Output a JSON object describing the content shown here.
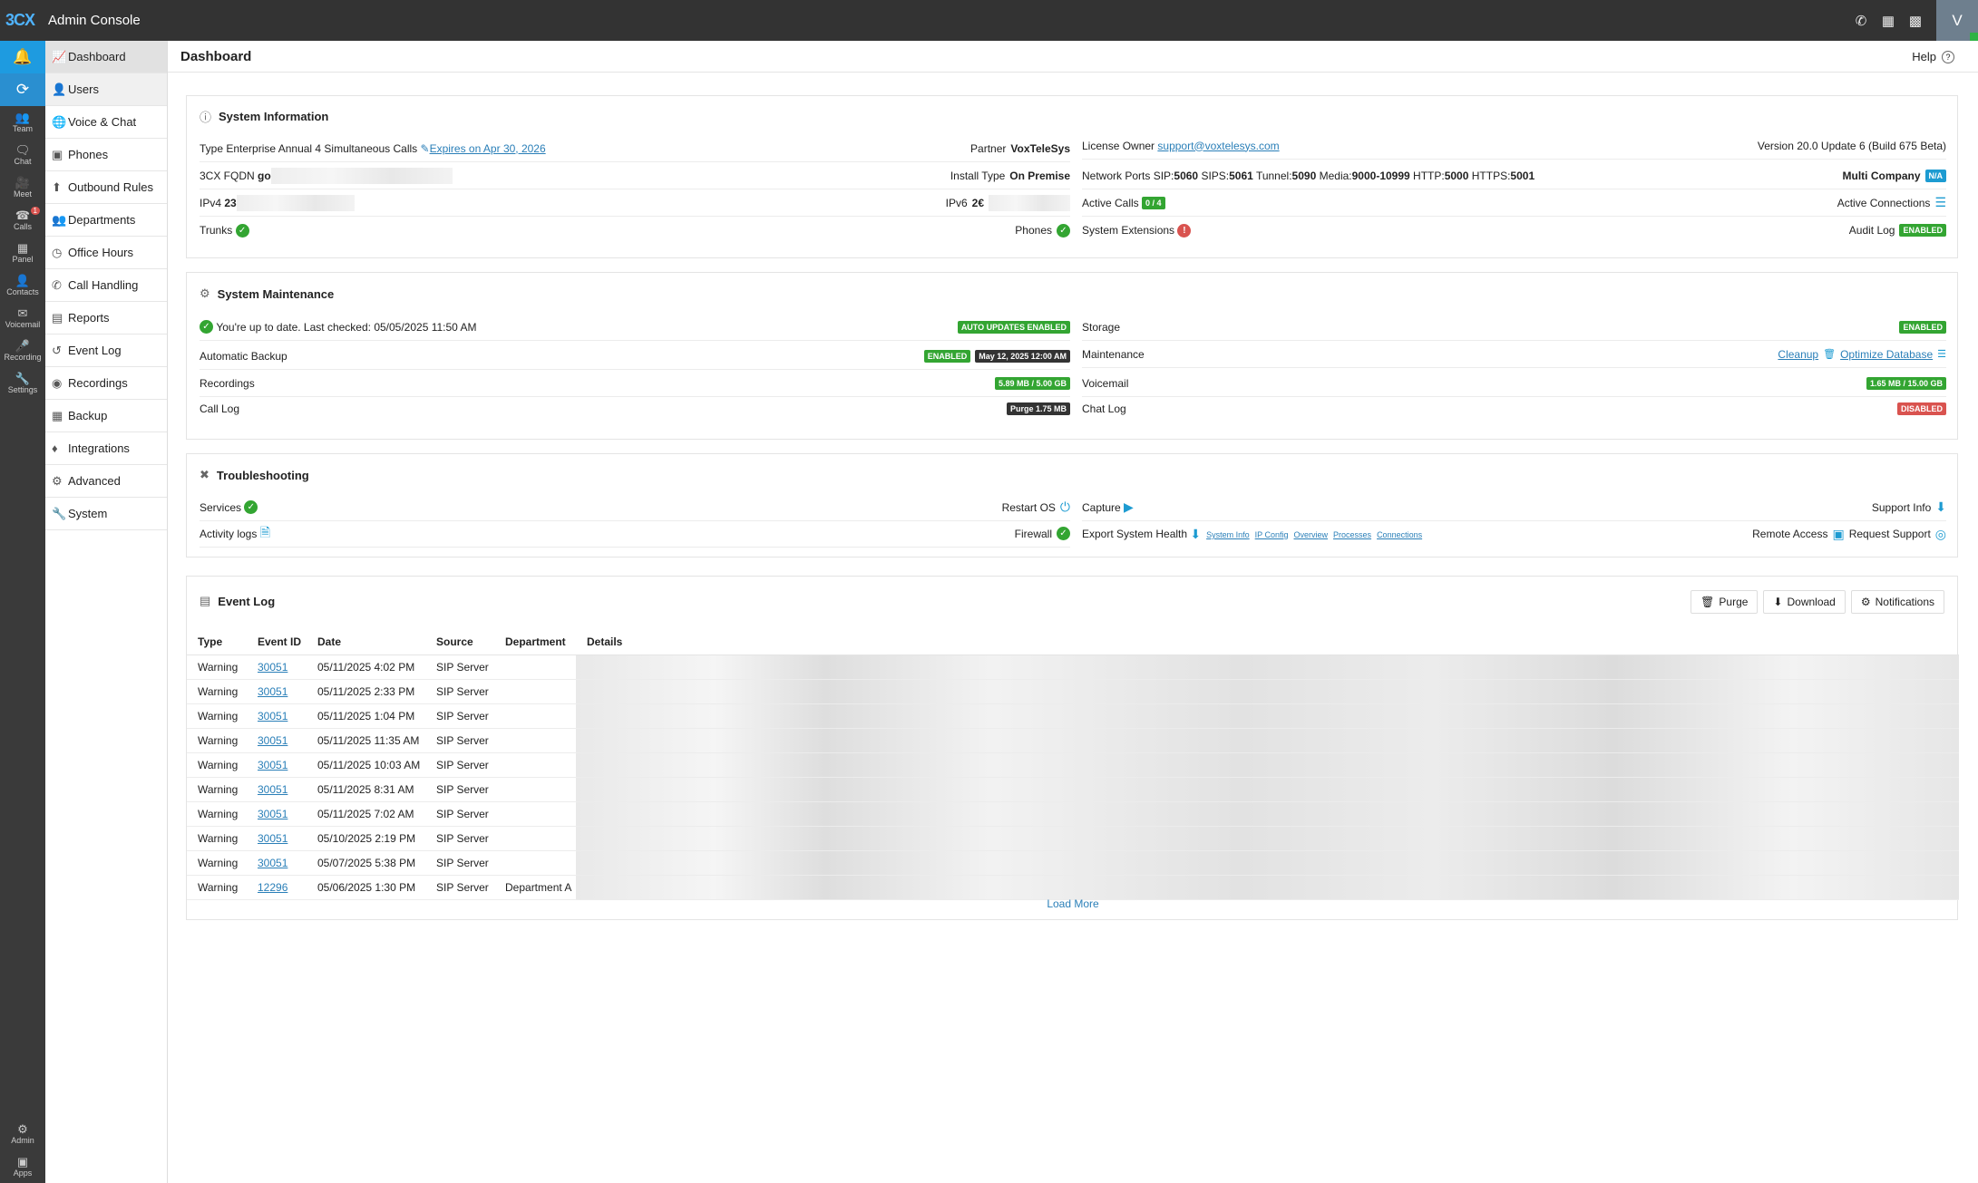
{
  "app": {
    "logo": "3CX",
    "title": "Admin Console",
    "avatar_initial": "V"
  },
  "topbar_icons": [
    "phone-icon",
    "qr-code-icon",
    "book-icon"
  ],
  "rail": {
    "items": [
      {
        "label": "Team",
        "icon": "team-icon"
      },
      {
        "label": "Chat",
        "icon": "chat-icon"
      },
      {
        "label": "Meet",
        "icon": "meet-icon"
      },
      {
        "label": "Calls",
        "icon": "calls-icon",
        "badge": "1"
      },
      {
        "label": "Panel",
        "icon": "panel-icon"
      },
      {
        "label": "Contacts",
        "icon": "contacts-icon"
      },
      {
        "label": "Voicemail",
        "icon": "voicemail-icon"
      },
      {
        "label": "Recording",
        "icon": "recording-icon"
      },
      {
        "label": "Settings",
        "icon": "settings-icon"
      }
    ],
    "bottom": [
      {
        "label": "Admin",
        "icon": "admin-icon"
      },
      {
        "label": "Apps",
        "icon": "apps-icon"
      }
    ]
  },
  "sidebar": {
    "items": [
      {
        "label": "Dashboard"
      },
      {
        "label": "Users"
      },
      {
        "label": "Voice & Chat"
      },
      {
        "label": "Phones"
      },
      {
        "label": "Outbound Rules"
      },
      {
        "label": "Departments"
      },
      {
        "label": "Office Hours"
      },
      {
        "label": "Call Handling"
      },
      {
        "label": "Reports"
      },
      {
        "label": "Event Log"
      },
      {
        "label": "Recordings"
      },
      {
        "label": "Backup"
      },
      {
        "label": "Integrations"
      },
      {
        "label": "Advanced"
      },
      {
        "label": "System"
      }
    ]
  },
  "header": {
    "title": "Dashboard",
    "help": "Help"
  },
  "sysinfo": {
    "title": "System Information",
    "type_label": "Type",
    "type_value": "Enterprise Annual  4 Simultaneous Calls",
    "expires": "Expires on Apr 30, 2026",
    "partner_label": "Partner",
    "partner_value": "VoxTeleSys",
    "license_owner_label": "License Owner",
    "license_owner_value": "support@voxtelesys.com",
    "version": "Version 20.0 Update 6 (Build 675 Beta)",
    "fqdn_label": "3CX FQDN",
    "fqdn_value": "go",
    "install_label": "Install Type",
    "install_value": "On Premise",
    "ports_label": "Network Ports",
    "ports": [
      {
        "k": "SIP:",
        "v": "5060"
      },
      {
        "k": "SIPS:",
        "v": "5061"
      },
      {
        "k": "Tunnel:",
        "v": "5090"
      },
      {
        "k": "Media:",
        "v": "9000-10999"
      },
      {
        "k": "HTTP:",
        "v": "5000"
      },
      {
        "k": "HTTPS:",
        "v": "5001"
      }
    ],
    "multi_company": "Multi Company",
    "multi_company_badge": "N/A",
    "ipv4_label": "IPv4",
    "ipv4_value": "23",
    "ipv6_label": "IPv6",
    "ipv6_value": "2€",
    "active_calls_label": "Active Calls",
    "active_calls_badge": "0 / 4",
    "active_conn_label": "Active Connections",
    "trunks_label": "Trunks",
    "phones_label": "Phones",
    "sys_ext_label": "System Extensions",
    "audit_label": "Audit Log",
    "audit_badge": "ENABLED"
  },
  "maintenance": {
    "title": "System Maintenance",
    "uptodate": "You're up to date. Last checked: 05/05/2025 11:50 AM",
    "auto_updates_badge": "AUTO UPDATES ENABLED",
    "storage_label": "Storage",
    "storage_badge": "ENABLED",
    "backup_label": "Automatic Backup",
    "backup_badge": "ENABLED",
    "backup_date": "May 12, 2025 12:00 AM",
    "maint_label": "Maintenance",
    "cleanup": "Cleanup",
    "optimize": "Optimize Database",
    "recordings_label": "Recordings",
    "recordings_badge": "5.89 MB / 5.00 GB",
    "voicemail_label": "Voicemail",
    "voicemail_badge": "1.65 MB / 15.00 GB",
    "calllog_label": "Call Log",
    "calllog_badge": "Purge 1.75 MB",
    "chatlog_label": "Chat Log",
    "chatlog_badge": "DISABLED"
  },
  "troubleshooting": {
    "title": "Troubleshooting",
    "services_label": "Services",
    "restart_label": "Restart OS",
    "capture_label": "Capture",
    "support_info_label": "Support Info",
    "activity_label": "Activity logs",
    "firewall_label": "Firewall",
    "export_label": "Export System Health",
    "export_links": [
      "System Info",
      "IP Config",
      "Overview",
      "Processes",
      "Connections"
    ],
    "remote_label": "Remote Access",
    "request_label": "Request Support"
  },
  "eventlog": {
    "title": "Event Log",
    "buttons": {
      "purge": "Purge",
      "download": "Download",
      "notifications": "Notifications"
    },
    "columns": [
      "Type",
      "Event ID",
      "Date",
      "Source",
      "Department",
      "Details"
    ],
    "rows": [
      {
        "type": "Warning",
        "id": "30051",
        "date": "05/11/2025 4:02 PM",
        "source": "SIP Server",
        "dept": ""
      },
      {
        "type": "Warning",
        "id": "30051",
        "date": "05/11/2025 2:33 PM",
        "source": "SIP Server",
        "dept": ""
      },
      {
        "type": "Warning",
        "id": "30051",
        "date": "05/11/2025 1:04 PM",
        "source": "SIP Server",
        "dept": ""
      },
      {
        "type": "Warning",
        "id": "30051",
        "date": "05/11/2025 11:35 AM",
        "source": "SIP Server",
        "dept": ""
      },
      {
        "type": "Warning",
        "id": "30051",
        "date": "05/11/2025 10:03 AM",
        "source": "SIP Server",
        "dept": ""
      },
      {
        "type": "Warning",
        "id": "30051",
        "date": "05/11/2025 8:31 AM",
        "source": "SIP Server",
        "dept": ""
      },
      {
        "type": "Warning",
        "id": "30051",
        "date": "05/11/2025 7:02 AM",
        "source": "SIP Server",
        "dept": ""
      },
      {
        "type": "Warning",
        "id": "30051",
        "date": "05/10/2025 2:19 PM",
        "source": "SIP Server",
        "dept": ""
      },
      {
        "type": "Warning",
        "id": "30051",
        "date": "05/07/2025 5:38 PM",
        "source": "SIP Server",
        "dept": ""
      },
      {
        "type": "Warning",
        "id": "12296",
        "date": "05/06/2025 1:30 PM",
        "source": "SIP Server",
        "dept": "Department A"
      }
    ],
    "load_more": "Load More"
  }
}
